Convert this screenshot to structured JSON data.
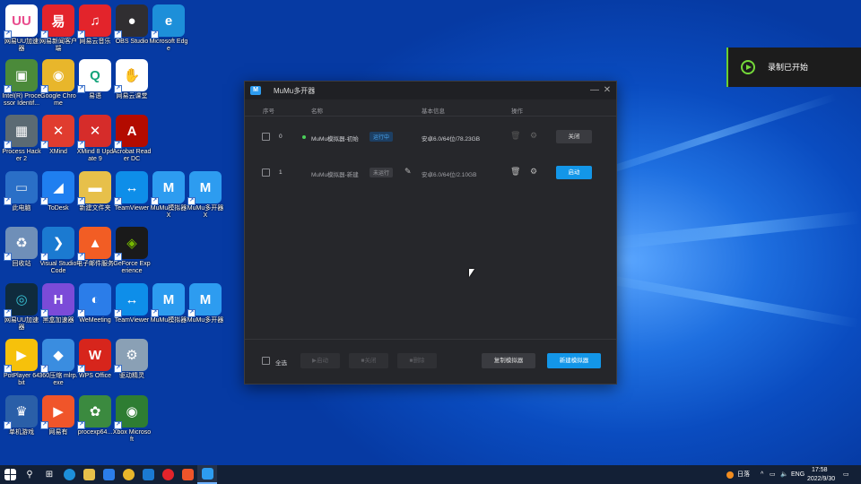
{
  "desktop": {
    "icons": [
      {
        "label": "网易UU加速器",
        "glyph": "UU",
        "color": "#e94b8c",
        "bg": "#fff"
      },
      {
        "label": "网易新闻客户端",
        "glyph": "易",
        "color": "#fff",
        "bg": "#e3242b"
      },
      {
        "label": "网易云音乐",
        "glyph": "♫",
        "color": "#fff",
        "bg": "#e3242b"
      },
      {
        "label": "OBS Studio",
        "glyph": "●",
        "color": "#fff",
        "bg": "#302e31"
      },
      {
        "label": "Microsoft Edge",
        "glyph": "e",
        "color": "#fff",
        "bg": "#1d8fd9"
      },
      {
        "label": "Intel(R) Processor Identif...",
        "glyph": "▣",
        "color": "#fff",
        "bg": "#4b8a3a"
      },
      {
        "label": "Google Chrome",
        "glyph": "◉",
        "color": "#fff",
        "bg": "#e8b62b"
      },
      {
        "label": "易语",
        "glyph": "Q",
        "color": "#13a37a",
        "bg": "#fff"
      },
      {
        "label": "网易云课堂",
        "glyph": "✋",
        "color": "#2e86de",
        "bg": "#fff"
      },
      {
        "label": "Process Hacker 2",
        "glyph": "▦",
        "color": "#fff",
        "bg": "#5b6a73"
      },
      {
        "label": "XMind",
        "glyph": "✕",
        "color": "#fff",
        "bg": "#e03c2f"
      },
      {
        "label": "XMind 8 Update 9",
        "glyph": "✕",
        "color": "#fff",
        "bg": "#d62c2a"
      },
      {
        "label": "Acrobat Reader DC",
        "glyph": "A",
        "color": "#fff",
        "bg": "#b30b00"
      },
      {
        "label": "此电脑",
        "glyph": "▭",
        "color": "#cde",
        "bg": "#2a6fc7"
      },
      {
        "label": "ToDesk",
        "glyph": "◢",
        "color": "#fff",
        "bg": "#1f7ff0"
      },
      {
        "label": "新建文件夹",
        "glyph": "▬",
        "color": "#fff",
        "bg": "#e7c04a"
      },
      {
        "label": "TeamViewer",
        "glyph": "↔",
        "color": "#fff",
        "bg": "#0e8ee9"
      },
      {
        "label": "MuMu模拟器X",
        "glyph": "M",
        "color": "#fff",
        "bg": "#2d9cf0"
      },
      {
        "label": "MuMu多开器X",
        "glyph": "M",
        "color": "#fff",
        "bg": "#2d9cf0"
      },
      {
        "label": "回收站",
        "glyph": "♻",
        "color": "#fff",
        "bg": "#6f8fb8"
      },
      {
        "label": "Visual Studio Code",
        "glyph": "❯",
        "color": "#fff",
        "bg": "#1b7ad1"
      },
      {
        "label": "电子邮件服务",
        "glyph": "▲",
        "color": "#fff",
        "bg": "#f25d24"
      },
      {
        "label": "GeForce Experience",
        "glyph": "◈",
        "color": "#76b900",
        "bg": "#1a1a1a"
      },
      {
        "label": "网易UU加速器",
        "glyph": "◎",
        "color": "#39c4d6",
        "bg": "#0f2b3d"
      },
      {
        "label": "黑盒加速器",
        "glyph": "H",
        "color": "#fff",
        "bg": "#7b4bd8"
      },
      {
        "label": "WeMeeting",
        "glyph": "◐",
        "color": "#fff",
        "bg": "#2b7de9"
      },
      {
        "label": "TeamViewer",
        "glyph": "↔",
        "color": "#fff",
        "bg": "#0e8ee9"
      },
      {
        "label": "MuMu模拟器",
        "glyph": "M",
        "color": "#fff",
        "bg": "#2d9cf0"
      },
      {
        "label": "MuMu多开器",
        "glyph": "M",
        "color": "#fff",
        "bg": "#2d9cf0"
      },
      {
        "label": "PotPlayer 64 bit",
        "glyph": "▶",
        "color": "#fff",
        "bg": "#f6c10b"
      },
      {
        "label": "360压缩 mlrp.exe",
        "glyph": "◆",
        "color": "#fff",
        "bg": "#3a8de0"
      },
      {
        "label": "WPS Office",
        "glyph": "W",
        "color": "#fff",
        "bg": "#d7251c"
      },
      {
        "label": "驱动精灵",
        "glyph": "⚙",
        "color": "#fff",
        "bg": "#8aa0b5"
      },
      {
        "label": "单机游戏",
        "glyph": "♛",
        "color": "#fff",
        "bg": "#2a5fa8"
      },
      {
        "label": "网易有",
        "glyph": "▶",
        "color": "#fff",
        "bg": "#f0552a"
      },
      {
        "label": "procexp64...",
        "glyph": "✿",
        "color": "#fff",
        "bg": "#3b8a3f"
      },
      {
        "label": "Xbox Microsoft",
        "glyph": "◉",
        "color": "#fff",
        "bg": "#2e7d32"
      }
    ]
  },
  "notification": {
    "text": "录制已开始"
  },
  "window": {
    "title": "MuMu多开器",
    "minimize": "—",
    "close": "✕",
    "columns": {
      "index": "序号",
      "name": "名称",
      "info": "基本信息",
      "actions": "操作"
    },
    "rows": [
      {
        "index": "0",
        "name": "MuMu模拟器-初始",
        "status": "运行中",
        "info": "安卓6.0/64位/78.23GB",
        "action": "关闭"
      },
      {
        "index": "1",
        "name": "MuMu模拟器-新建",
        "status": "未运行",
        "info": "安卓6.0/64位/2.10GB",
        "action": "启动"
      }
    ],
    "footer": {
      "select_all": "全选",
      "btn_start": "▶启动",
      "btn_stop": "■关闭",
      "btn_delete": "■删除",
      "copy": "复制模拟器",
      "create": "新建模拟器"
    }
  },
  "taskbar": {
    "weather": "日落",
    "ime": "ENG",
    "time": "17:58",
    "date": "2022/9/30"
  },
  "colors": {
    "accent": "#1396e8",
    "running": "#4ad05a",
    "window_bg": "#26272b"
  }
}
